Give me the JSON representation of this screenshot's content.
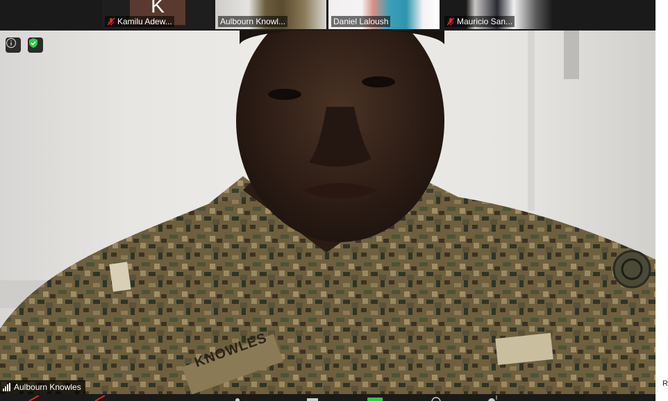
{
  "gallery": {
    "participants": [
      {
        "name": "Kamilu Adew...",
        "muted": true,
        "avatar_letter": "K"
      },
      {
        "name": "Aulbourn Knowl...",
        "muted": false,
        "active": true
      },
      {
        "name": "Daniel Laloush",
        "muted": false
      },
      {
        "name": "Mauricio San...",
        "muted": true
      }
    ]
  },
  "main_video": {
    "speaker_name": "Aulbourn Knowles",
    "uniform_tape": "KNOWLES"
  },
  "icons": {
    "info": "info-icon",
    "security": "shield-check-icon",
    "signal": "signal-bars-icon",
    "mute": "mic-muted-icon"
  },
  "colors": {
    "active_border": "#9acd32",
    "security_green": "#2ecc40",
    "mute_red": "#e02828"
  },
  "side_panel": {
    "partial_text": "R"
  }
}
